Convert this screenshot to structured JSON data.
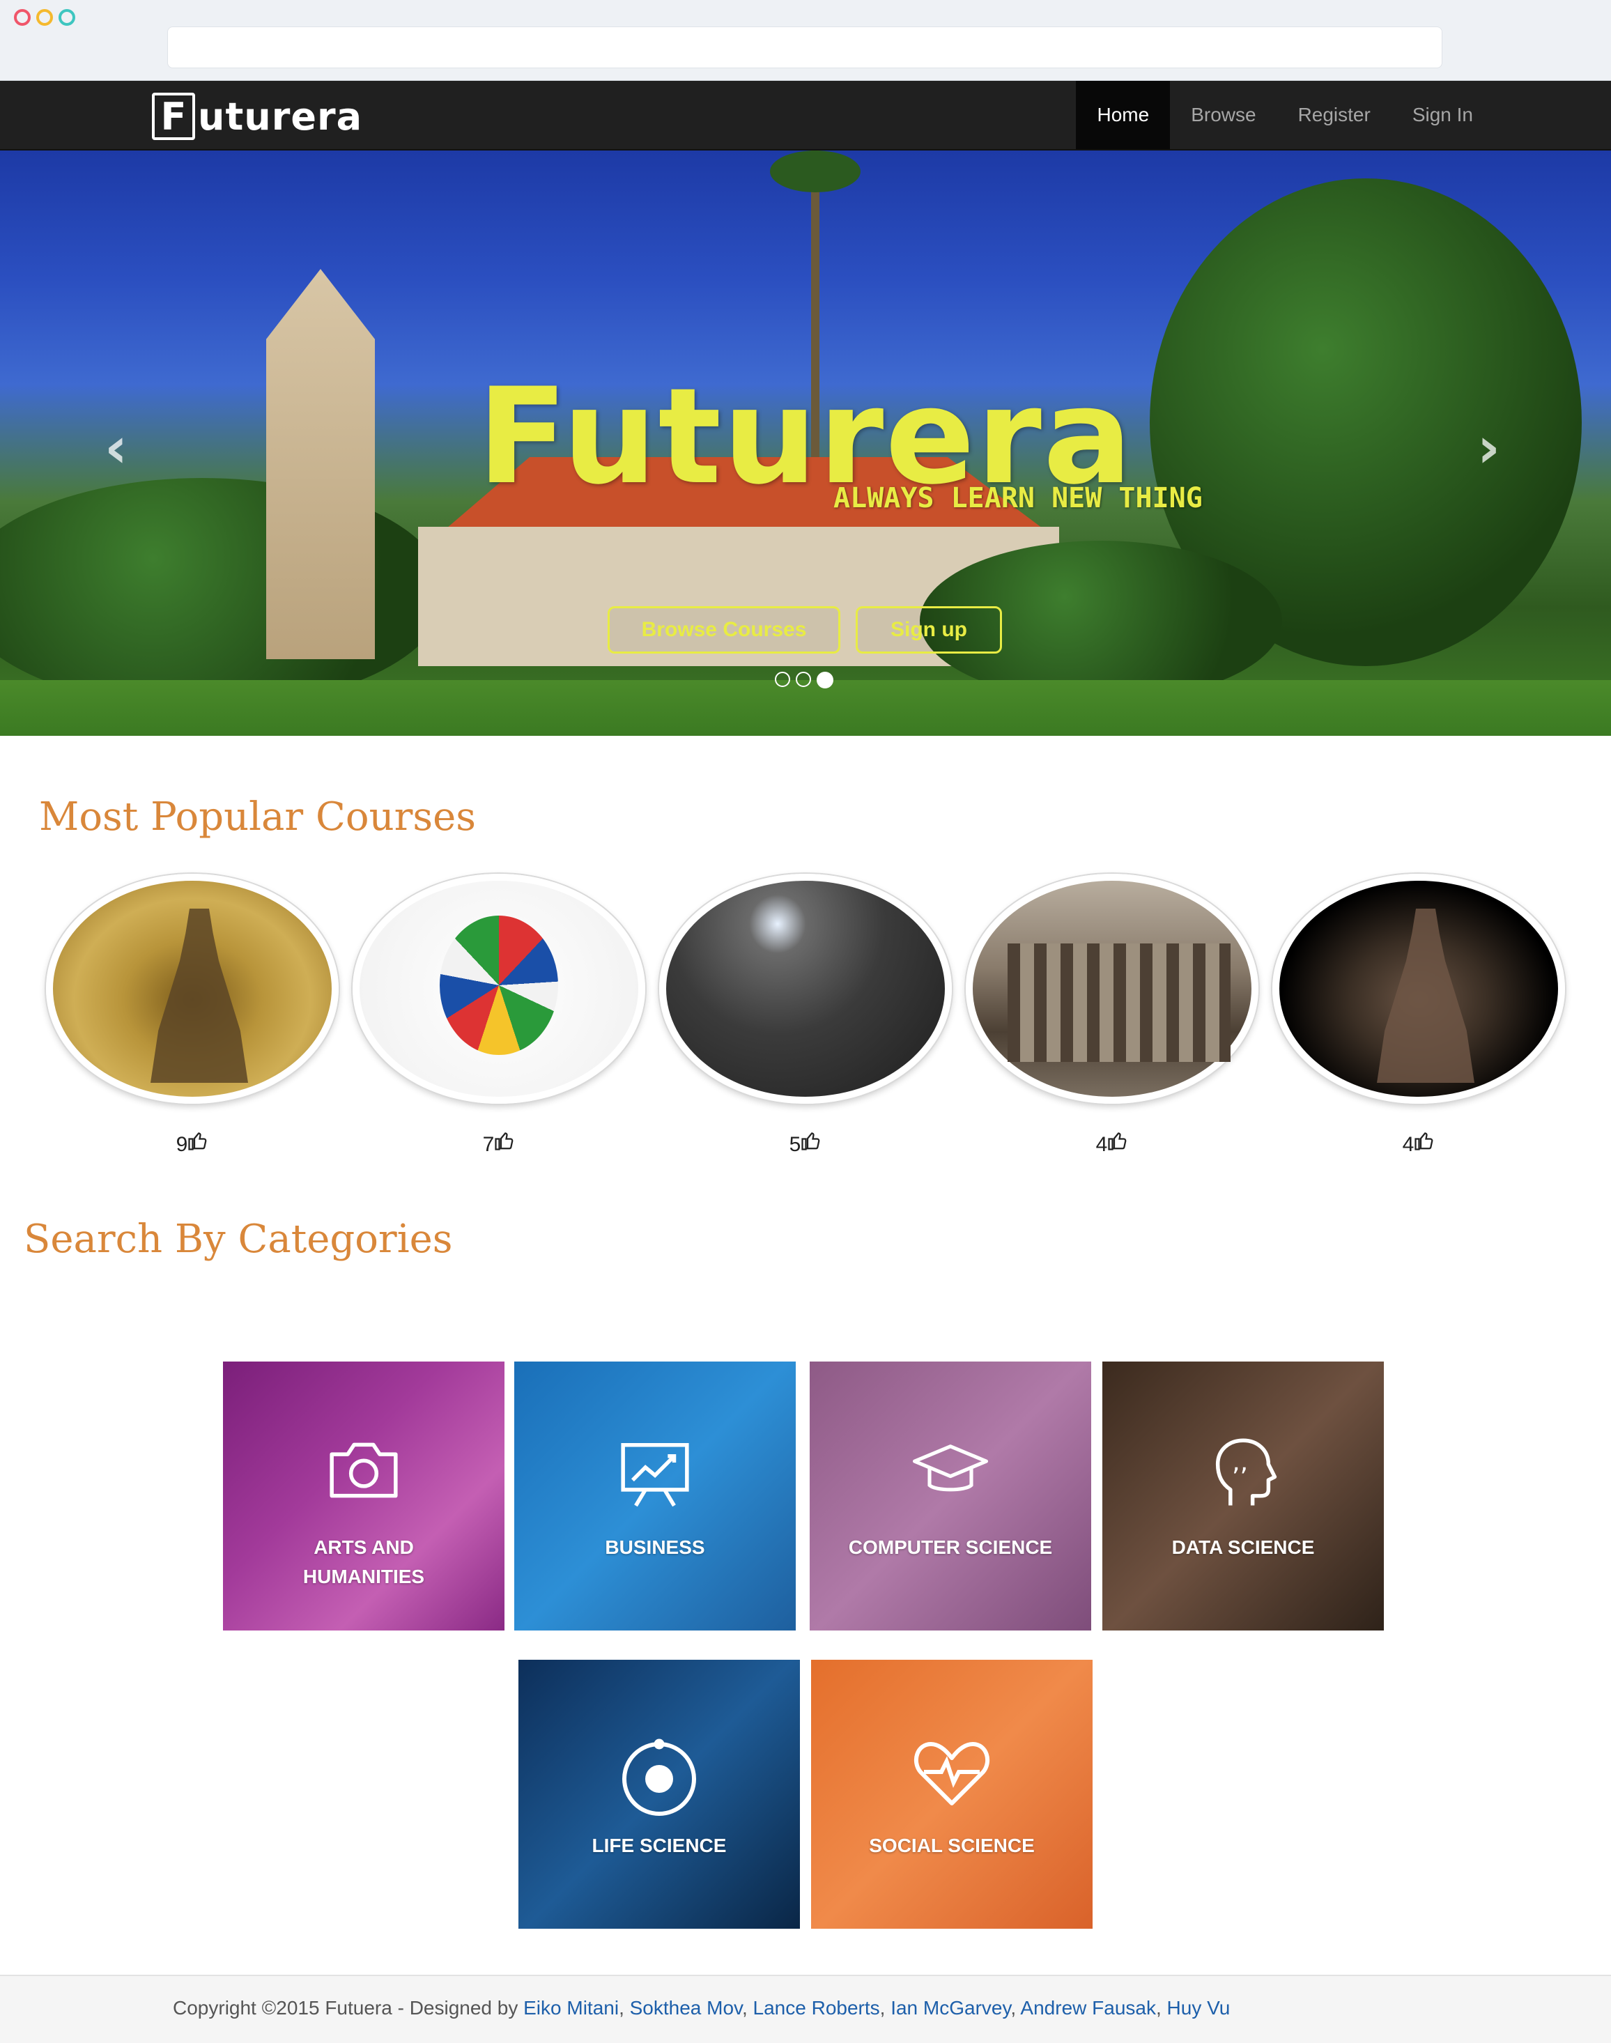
{
  "nav": {
    "logo_letter": "F",
    "logo_rest": "uturera",
    "items": [
      {
        "label": "Home",
        "active": true
      },
      {
        "label": "Browse",
        "active": false
      },
      {
        "label": "Register",
        "active": false
      },
      {
        "label": "Sign In",
        "active": false
      }
    ]
  },
  "hero": {
    "title": "Futurera",
    "tagline": "ALWAYS LEARN NEW THING",
    "browse_label": "Browse Courses",
    "signup_label": "Sign up",
    "arrow_left": "‹",
    "arrow_right": "›",
    "slides": 3,
    "active_slide": 3
  },
  "popular": {
    "title": "Most Popular Courses",
    "courses": [
      {
        "likes": "9"
      },
      {
        "likes": "7"
      },
      {
        "likes": "5"
      },
      {
        "likes": "4"
      },
      {
        "likes": "4"
      }
    ]
  },
  "categories": {
    "title": "Search By Categories",
    "items": [
      {
        "line1": "ARTS AND",
        "line2": "HUMANITIES",
        "icon": "camera-icon"
      },
      {
        "line1": "BUSINESS",
        "icon": "chart-board-icon"
      },
      {
        "line1": "COMPUTER SCIENCE",
        "icon": "graduation-cap-icon"
      },
      {
        "line1": "DATA SCIENCE",
        "icon": "head-quote-icon"
      },
      {
        "line1": "LIFE SCIENCE",
        "icon": "atom-circle-icon"
      },
      {
        "line1": "SOCIAL SCIENCE",
        "icon": "heart-pulse-icon"
      }
    ]
  },
  "footer": {
    "prefix": "Copyright ©2015 Futuera - Designed by ",
    "authors": [
      "Eiko Mitani",
      "Sokthea Mov",
      "Lance Roberts",
      "Ian McGarvey",
      "Andrew Fausak",
      "Huy Vu"
    ],
    "separator": ", "
  },
  "colors": {
    "accent_yellow": "#e8ec44",
    "section_title": "#d9873a",
    "nav_bg": "#202020",
    "link": "#1d5faa"
  }
}
